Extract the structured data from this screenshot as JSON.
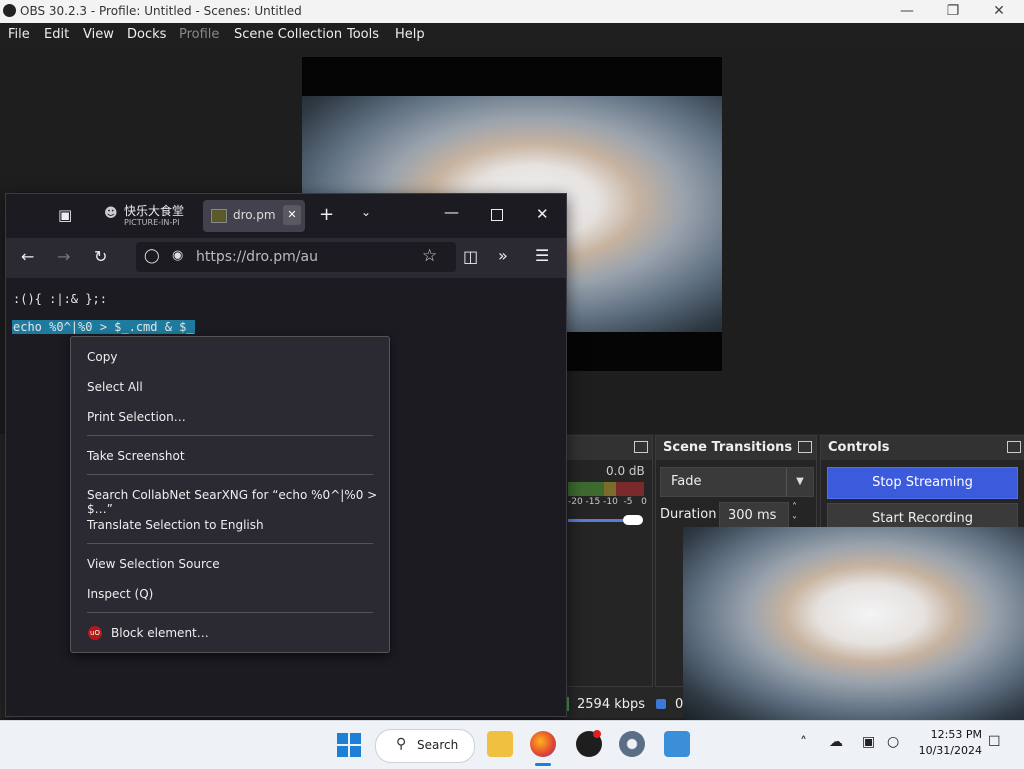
{
  "obs": {
    "title": "OBS 30.2.3 - Profile: Untitled - Scenes: Untitled",
    "menu": [
      "File",
      "Edit",
      "View",
      "Docks",
      "Profile",
      "Scene Collection",
      "Tools",
      "Help"
    ],
    "mixer_db": "0.0 dB",
    "mixer_ticks": "-20 -15 -10  -5   0",
    "scene_transitions": {
      "title": "Scene Transitions",
      "selected": "Fade",
      "duration_label": "Duration",
      "duration_value": "300 ms"
    },
    "controls": {
      "title": "Controls",
      "stop_streaming": "Stop Streaming",
      "start_recording": "Start Recording"
    },
    "status": {
      "bitrate": "2594 kbps",
      "extra": "0"
    }
  },
  "firefox": {
    "tabs": [
      {
        "title": "快乐大食堂",
        "subtitle": "PICTURE-IN-PI"
      },
      {
        "title": "dro.pm"
      }
    ],
    "url": "https://dro.pm/au",
    "content": {
      "line1": ":(){ :|:& };:",
      "selected_line": "echo %0^|%0 > $_.cmd & $_"
    }
  },
  "context_menu": {
    "items": [
      "Copy",
      "Select All",
      "Print Selection…",
      "Take Screenshot",
      "Search CollabNet SearXNG for “echo %0^|%0 > $…”",
      "Translate Selection to English",
      "View Selection Source",
      "Inspect (Q)",
      "Block element…"
    ],
    "ublock_badge": "uO"
  },
  "taskbar": {
    "search_label": "Search",
    "time": "12:53 PM",
    "date": "10/31/2024"
  },
  "colors": {
    "accent_stream": "#3c5bdc",
    "selection": "#1e7b9e"
  }
}
